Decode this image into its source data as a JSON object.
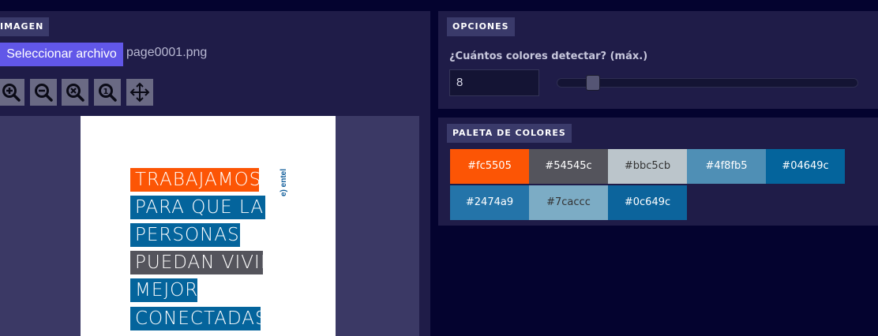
{
  "imagen": {
    "tag": "IMAGEN",
    "file_button": "Seleccionar archivo",
    "file_name": "page0001.png",
    "tools": [
      {
        "name": "zoom-in-icon"
      },
      {
        "name": "zoom-out-icon"
      },
      {
        "name": "zoom-reset-icon"
      },
      {
        "name": "zoom-actual-icon"
      },
      {
        "name": "move-icon"
      }
    ],
    "preview": {
      "headline": [
        {
          "text": "TRABAJAMOS",
          "color": "#fc5505"
        },
        {
          "text": "PARA QUE LAS",
          "color": "#04649c"
        },
        {
          "text": "PERSONAS",
          "color": "#04649c"
        },
        {
          "text": "PUEDAN VIVIR",
          "color": "#54545c"
        },
        {
          "text": "MEJOR",
          "color": "#04649c"
        },
        {
          "text": "CONECTADAS",
          "color": "#04649c"
        }
      ],
      "logo": "e) entel"
    }
  },
  "opciones": {
    "tag": "OPCIONES",
    "question": "¿Cuántos colores detectar? (máx.)",
    "value": "8",
    "slider_fraction": 0.1
  },
  "paleta": {
    "tag": "PALETA DE COLORES",
    "colors": [
      {
        "hex": "#fc5505",
        "label": "#fc5505",
        "text": "#ffffff"
      },
      {
        "hex": "#54545c",
        "label": "#54545c",
        "text": "#ffffff"
      },
      {
        "hex": "#bbc5cb",
        "label": "#bbc5cb",
        "text": "#333333"
      },
      {
        "hex": "#4f8fb5",
        "label": "#4f8fb5",
        "text": "#ffffff"
      },
      {
        "hex": "#04649c",
        "label": "#04649c",
        "text": "#ffffff"
      },
      {
        "hex": "#2474a9",
        "label": "#2474a9",
        "text": "#ffffff"
      },
      {
        "hex": "#7cacc5",
        "label": "#7caccc",
        "text": "#333333"
      },
      {
        "hex": "#0c649c",
        "label": "#0c649c",
        "text": "#ffffff"
      }
    ]
  }
}
